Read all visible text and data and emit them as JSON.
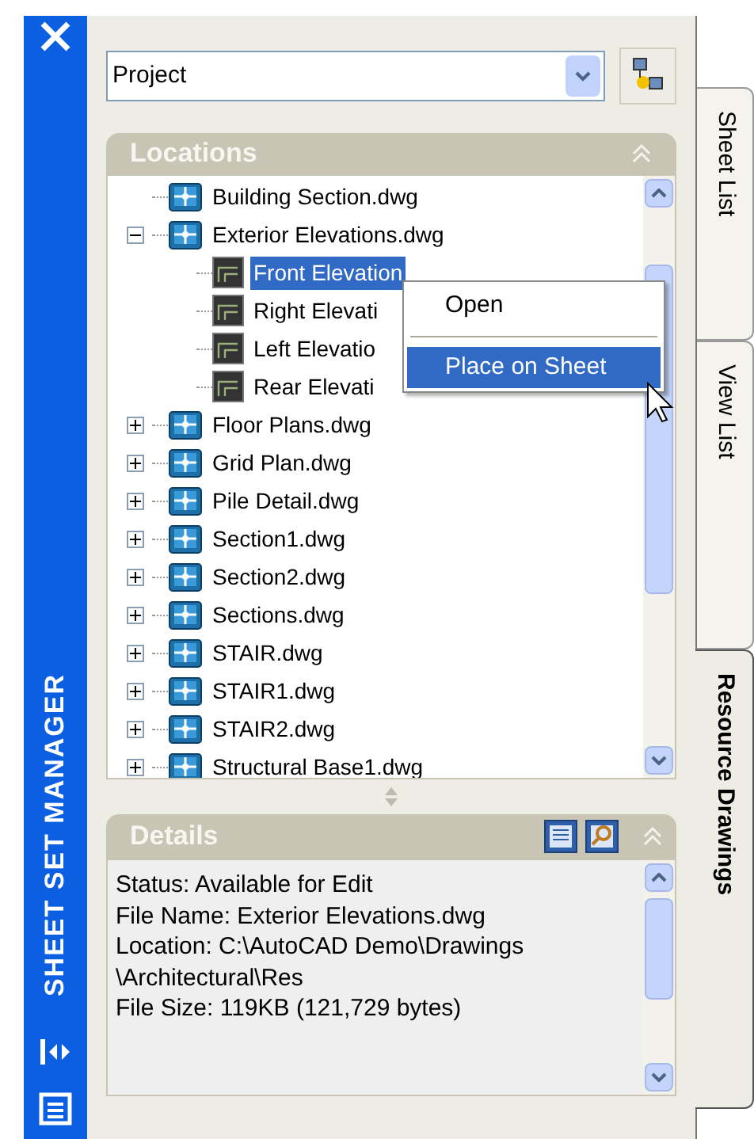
{
  "palette": {
    "title": "SHEET SET MANAGER"
  },
  "selector": {
    "value": "Project"
  },
  "locations": {
    "title": "Locations",
    "tree": [
      {
        "label": "Building Section.dwg",
        "kind": "drawing",
        "selected": false
      },
      {
        "label": "Exterior Elevations.dwg",
        "kind": "drawing",
        "selected": false,
        "expanded": true,
        "children": [
          {
            "label": "Front Elevation",
            "kind": "view",
            "selected": true
          },
          {
            "label": "Right Elevati",
            "kind": "view",
            "selected": false
          },
          {
            "label": "Left Elevatio",
            "kind": "view",
            "selected": false
          },
          {
            "label": "Rear Elevati",
            "kind": "view",
            "selected": false
          }
        ]
      },
      {
        "label": "Floor Plans.dwg",
        "kind": "drawing",
        "selected": false,
        "expanded": false
      },
      {
        "label": "Grid Plan.dwg",
        "kind": "drawing",
        "selected": false,
        "expanded": false
      },
      {
        "label": "Pile Detail.dwg",
        "kind": "drawing",
        "selected": false,
        "expanded": false
      },
      {
        "label": "Section1.dwg",
        "kind": "drawing",
        "selected": false,
        "expanded": false
      },
      {
        "label": "Section2.dwg",
        "kind": "drawing",
        "selected": false,
        "expanded": false
      },
      {
        "label": "Sections.dwg",
        "kind": "drawing",
        "selected": false,
        "expanded": false
      },
      {
        "label": "STAIR.dwg",
        "kind": "drawing",
        "selected": false,
        "expanded": false
      },
      {
        "label": "STAIR1.dwg",
        "kind": "drawing",
        "selected": false,
        "expanded": false
      },
      {
        "label": "STAIR2.dwg",
        "kind": "drawing",
        "selected": false,
        "expanded": false
      },
      {
        "label": "Structural Base1.dwg",
        "kind": "drawing",
        "selected": false,
        "expanded": false
      }
    ]
  },
  "context_menu": {
    "items": [
      {
        "label": "Open",
        "selected": false
      },
      {
        "label": "Place on Sheet",
        "selected": true
      }
    ]
  },
  "details": {
    "title": "Details",
    "lines": [
      "Status: Available for Edit",
      "File Name: Exterior Elevations.dwg",
      "Location: C:\\AutoCAD Demo\\Drawings",
      "\\Architectural\\Res",
      "File Size: 119KB (121,729 bytes)"
    ]
  },
  "tabs": [
    {
      "label": "Sheet List",
      "selected": false
    },
    {
      "label": "View List",
      "selected": false
    },
    {
      "label": "Resource Drawings",
      "selected": true
    }
  ]
}
